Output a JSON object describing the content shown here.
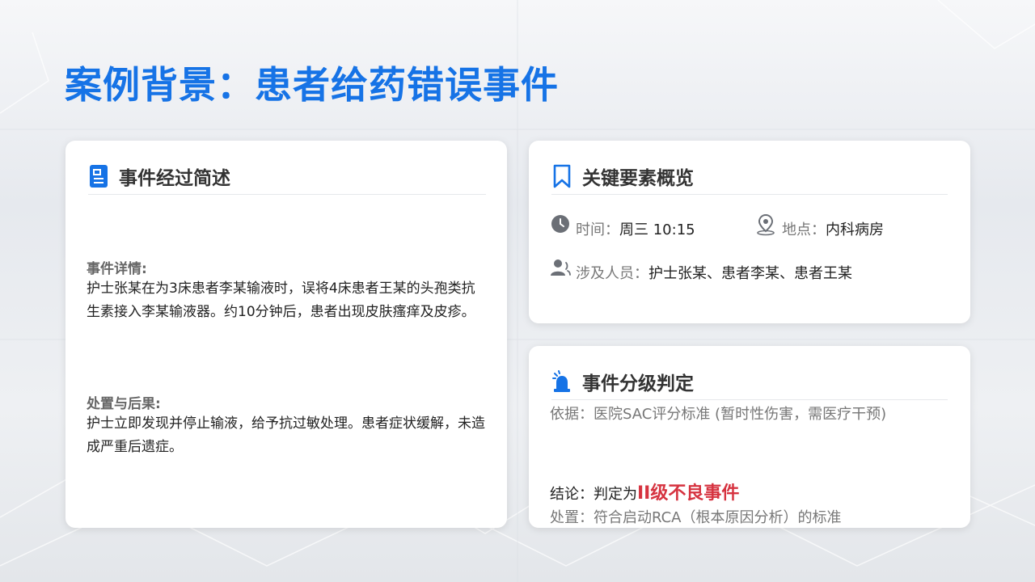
{
  "page": {
    "title": "案例背景：患者给药错误事件"
  },
  "event_card": {
    "title": "事件经过简述",
    "icon": "document-icon",
    "details_label": "事件详情:",
    "details_text": "护士张某在为3床患者李某输液时，误将4床患者王某的头孢类抗生素接入李某输液器。约10分钟后，患者出现皮肤瘙痒及皮疹。",
    "handling_label": "处置与后果:",
    "handling_text": "护士立即发现并停止输液，给予抗过敏处理。患者症状缓解，未造成严重后遗症。"
  },
  "elements_card": {
    "title": "关键要素概览",
    "icon": "bookmark-icon",
    "time_label": "时间：",
    "time_value": "周三 10:15",
    "place_label": "地点：",
    "place_value": "内科病房",
    "people_label": "涉及人员：",
    "people_value": "护士张某、患者李某、患者王某"
  },
  "grading_card": {
    "title": "事件分级判定",
    "icon": "siren-icon",
    "basis_label": "依据：",
    "basis_value": "医院SAC评分标准 (暂时性伤害，需医疗干预)",
    "conclusion_label": "结论：",
    "conclusion_prefix": "判定为",
    "conclusion_value": "II级不良事件",
    "action_label": "处置：",
    "action_value": "符合启动RCA（根本原因分析）的标准"
  },
  "colors": {
    "accent": "#1673e6",
    "danger": "#d63340"
  }
}
